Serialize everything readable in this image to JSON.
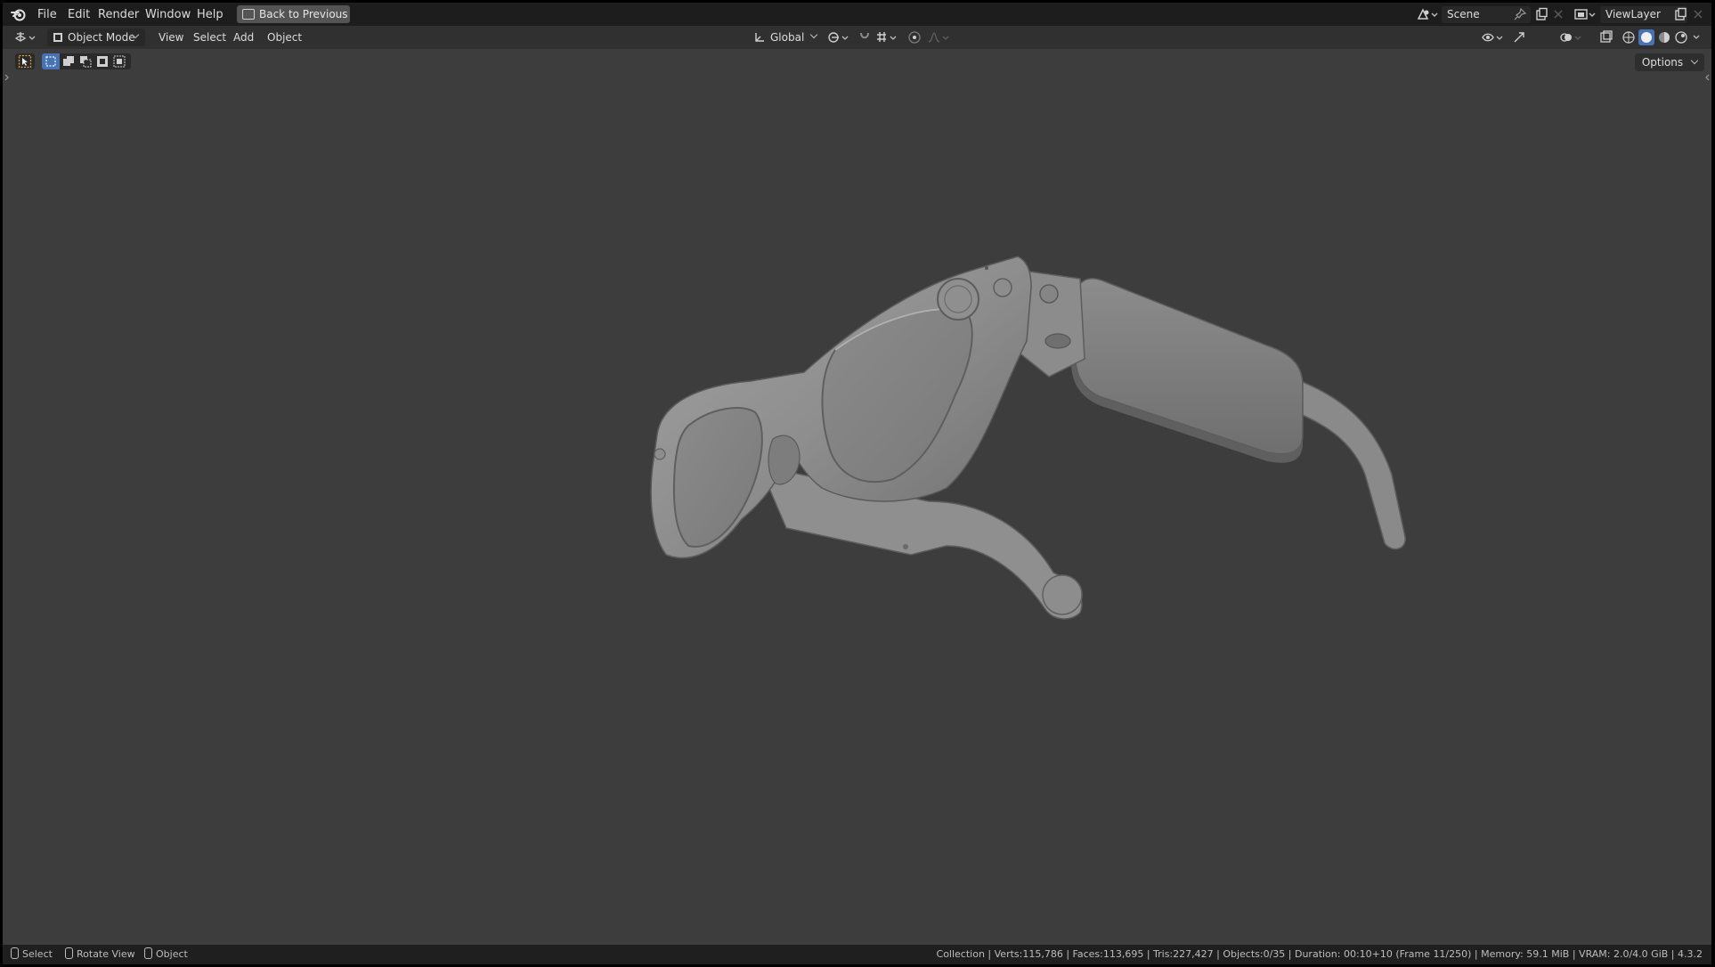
{
  "menubar": {
    "items": [
      "File",
      "Edit",
      "Render",
      "Window",
      "Help"
    ],
    "back_button": "Back to Previous",
    "scene_name": "Scene",
    "view_layer_name": "ViewLayer"
  },
  "header": {
    "mode": "Object Mode",
    "menus": [
      "View",
      "Select",
      "Add",
      "Object"
    ],
    "transform_orientation": "Global",
    "options_label": "Options"
  },
  "viewport": {
    "object": "glasses-model"
  },
  "statusbar": {
    "left": [
      {
        "icon": "mouse-left-icon",
        "label": "Select"
      },
      {
        "icon": "mouse-middle-icon",
        "label": "Rotate View"
      },
      {
        "icon": "mouse-right-icon",
        "label": "Object"
      }
    ],
    "stats": "Collection | Verts:115,786 | Faces:113,695 | Tris:227,427 | Objects:0/35 | Duration: 00:10+10 (Frame 11/250) | Memory: 59.1 MiB | VRAM: 2.0/4.0 GiB | 4.3.2"
  },
  "colors": {
    "viewport_bg": "#3d3d3d",
    "topbar_bg": "#1d1d1d",
    "header_bg": "#303030",
    "accent_blue": "#4772b3"
  }
}
